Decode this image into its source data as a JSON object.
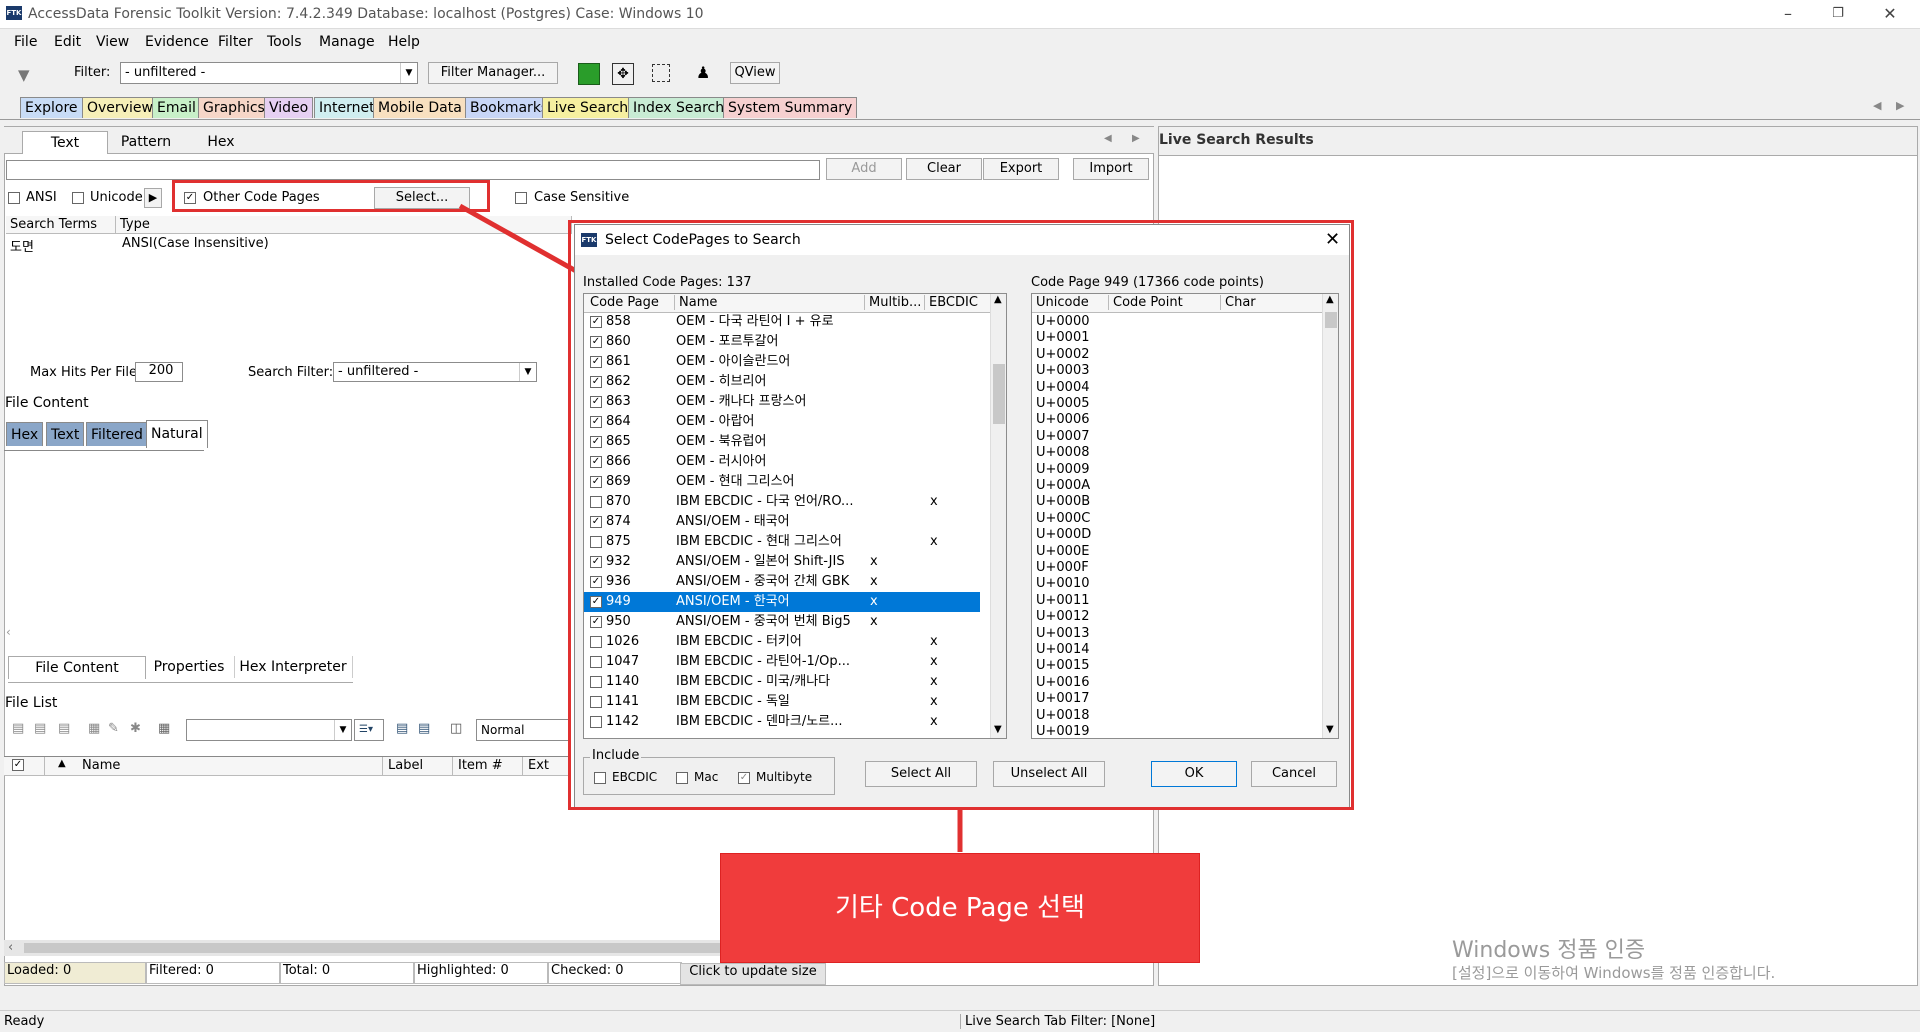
{
  "window": {
    "title": "AccessData Forensic Toolkit Version: 7.4.2.349 Database: localhost (Postgres) Case: Windows 10",
    "app_icon": "FTK"
  },
  "menu": [
    "File",
    "Edit",
    "View",
    "Evidence",
    "Filter",
    "Tools",
    "Manage",
    "Help"
  ],
  "toolbar": {
    "filter_label": "Filter:",
    "filter_value": "- unfiltered -",
    "filter_manager": "Filter Manager...",
    "qview": "QView"
  },
  "main_tabs": [
    "Explore",
    "Overview",
    "Email",
    "Graphics",
    "Video",
    "Internet",
    "Mobile Data",
    "Bookmarks",
    "Live Search",
    "Index Search",
    "System Summary"
  ],
  "search_tabs": [
    "Text",
    "Pattern",
    "Hex"
  ],
  "search_buttons": {
    "add": "Add",
    "clear": "Clear",
    "export": "Export",
    "import": "Import"
  },
  "options": {
    "ansi": "ANSI",
    "unicode": "Unicode",
    "other_code_pages": "Other Code Pages",
    "select": "Select...",
    "case_sensitive": "Case Sensitive"
  },
  "terms_table": {
    "headers": [
      "Search Terms",
      "Type"
    ],
    "rows": [
      {
        "term": "도면",
        "type": "ANSI(Case Insensitive)"
      }
    ]
  },
  "hits": {
    "max_hits_label": "Max Hits Per File:",
    "max_hits_value": "200",
    "search_filter_label": "Search Filter:",
    "search_filter_value": "- unfiltered -"
  },
  "file_content": {
    "title": "File Content",
    "tabs": [
      "Hex",
      "Text",
      "Filtered",
      "Natural"
    ]
  },
  "bottom_tabs": [
    "File Content",
    "Properties",
    "Hex Interpreter"
  ],
  "file_list": {
    "title": "File List",
    "view_value": "Normal",
    "headers": [
      "Name",
      "Label",
      "Item #",
      "Ext"
    ]
  },
  "counts": {
    "loaded": "Loaded: 0",
    "filtered": "Filtered: 0",
    "total": "Total: 0",
    "highlighted": "Highlighted: 0",
    "checked": "Checked: 0",
    "update": "Click to update size"
  },
  "right_panel": {
    "title": "Live Search Results"
  },
  "status": {
    "left": "Ready",
    "right": "Live Search Tab Filter: [None]"
  },
  "dialog": {
    "title": "Select CodePages to Search",
    "installed": "Installed Code Pages:  137",
    "headers": [
      "Code Page",
      "Name",
      "Multib...",
      "EBCDIC"
    ],
    "rows": [
      {
        "checked": true,
        "code": "858",
        "name": "OEM - 다국 라틴어 I + 유로",
        "multi": "",
        "ebcdic": ""
      },
      {
        "checked": true,
        "code": "860",
        "name": "OEM - 포르투갈어",
        "multi": "",
        "ebcdic": ""
      },
      {
        "checked": true,
        "code": "861",
        "name": "OEM - 아이슬란드어",
        "multi": "",
        "ebcdic": ""
      },
      {
        "checked": true,
        "code": "862",
        "name": "OEM - 히브리어",
        "multi": "",
        "ebcdic": ""
      },
      {
        "checked": true,
        "code": "863",
        "name": "OEM - 캐나다 프랑스어",
        "multi": "",
        "ebcdic": ""
      },
      {
        "checked": true,
        "code": "864",
        "name": "OEM - 아랍어",
        "multi": "",
        "ebcdic": ""
      },
      {
        "checked": true,
        "code": "865",
        "name": "OEM - 북유럽어",
        "multi": "",
        "ebcdic": ""
      },
      {
        "checked": true,
        "code": "866",
        "name": "OEM - 러시아어",
        "multi": "",
        "ebcdic": ""
      },
      {
        "checked": true,
        "code": "869",
        "name": "OEM - 현대 그리스어",
        "multi": "",
        "ebcdic": ""
      },
      {
        "checked": false,
        "code": "870",
        "name": "IBM EBCDIC - 다국 언어/RO...",
        "multi": "",
        "ebcdic": "x"
      },
      {
        "checked": true,
        "code": "874",
        "name": "ANSI/OEM - 태국어",
        "multi": "",
        "ebcdic": ""
      },
      {
        "checked": false,
        "code": "875",
        "name": "IBM EBCDIC - 현대 그리스어",
        "multi": "",
        "ebcdic": "x"
      },
      {
        "checked": true,
        "code": "932",
        "name": "ANSI/OEM - 일본어 Shift-JIS",
        "multi": "x",
        "ebcdic": ""
      },
      {
        "checked": true,
        "code": "936",
        "name": "ANSI/OEM - 중국어 간체 GBK",
        "multi": "x",
        "ebcdic": ""
      },
      {
        "checked": true,
        "code": "949",
        "name": "ANSI/OEM - 한국어",
        "multi": "x",
        "ebcdic": "",
        "selected": true
      },
      {
        "checked": true,
        "code": "950",
        "name": "ANSI/OEM - 중국어 번체 Big5",
        "multi": "x",
        "ebcdic": ""
      },
      {
        "checked": false,
        "code": "1026",
        "name": "IBM EBCDIC - 터키어",
        "multi": "",
        "ebcdic": "x"
      },
      {
        "checked": false,
        "code": "1047",
        "name": "IBM EBCDIC - 라틴어-1/Op...",
        "multi": "",
        "ebcdic": "x"
      },
      {
        "checked": false,
        "code": "1140",
        "name": "IBM EBCDIC - 미국/캐나다",
        "multi": "",
        "ebcdic": "x"
      },
      {
        "checked": false,
        "code": "1141",
        "name": "IBM EBCDIC - 독일",
        "multi": "",
        "ebcdic": "x"
      },
      {
        "checked": false,
        "code": "1142",
        "name": "IBM EBCDIC - 덴마크/노르...",
        "multi": "",
        "ebcdic": "x"
      }
    ],
    "codepage_info": "Code Page  949 (17366 code points)",
    "unicode_headers": [
      "Unicode",
      "Code Point",
      "Char"
    ],
    "unicode_rows": [
      "U+0000",
      "U+0001",
      "U+0002",
      "U+0003",
      "U+0004",
      "U+0005",
      "U+0006",
      "U+0007",
      "U+0008",
      "U+0009",
      "U+000A",
      "U+000B",
      "U+000C",
      "U+000D",
      "U+000E",
      "U+000F",
      "U+0010",
      "U+0011",
      "U+0012",
      "U+0013",
      "U+0014",
      "U+0015",
      "U+0016",
      "U+0017",
      "U+0018",
      "U+0019"
    ],
    "include": {
      "title": "Include",
      "ebcdic": "EBCDIC",
      "mac": "Mac",
      "multibyte": "Multibyte"
    },
    "buttons": {
      "select_all": "Select All",
      "unselect_all": "Unselect All",
      "ok": "OK",
      "cancel": "Cancel"
    }
  },
  "callout": {
    "text": "기타 Code Page 선택"
  },
  "watermark": {
    "line1": "Windows 정품 인증",
    "line2": "[설정]으로 이동하여 Windows를 정품 인증합니다."
  },
  "colors": {
    "accent_red": "#e03030",
    "selection": "#0078d7",
    "callout": "#f03c3c"
  }
}
